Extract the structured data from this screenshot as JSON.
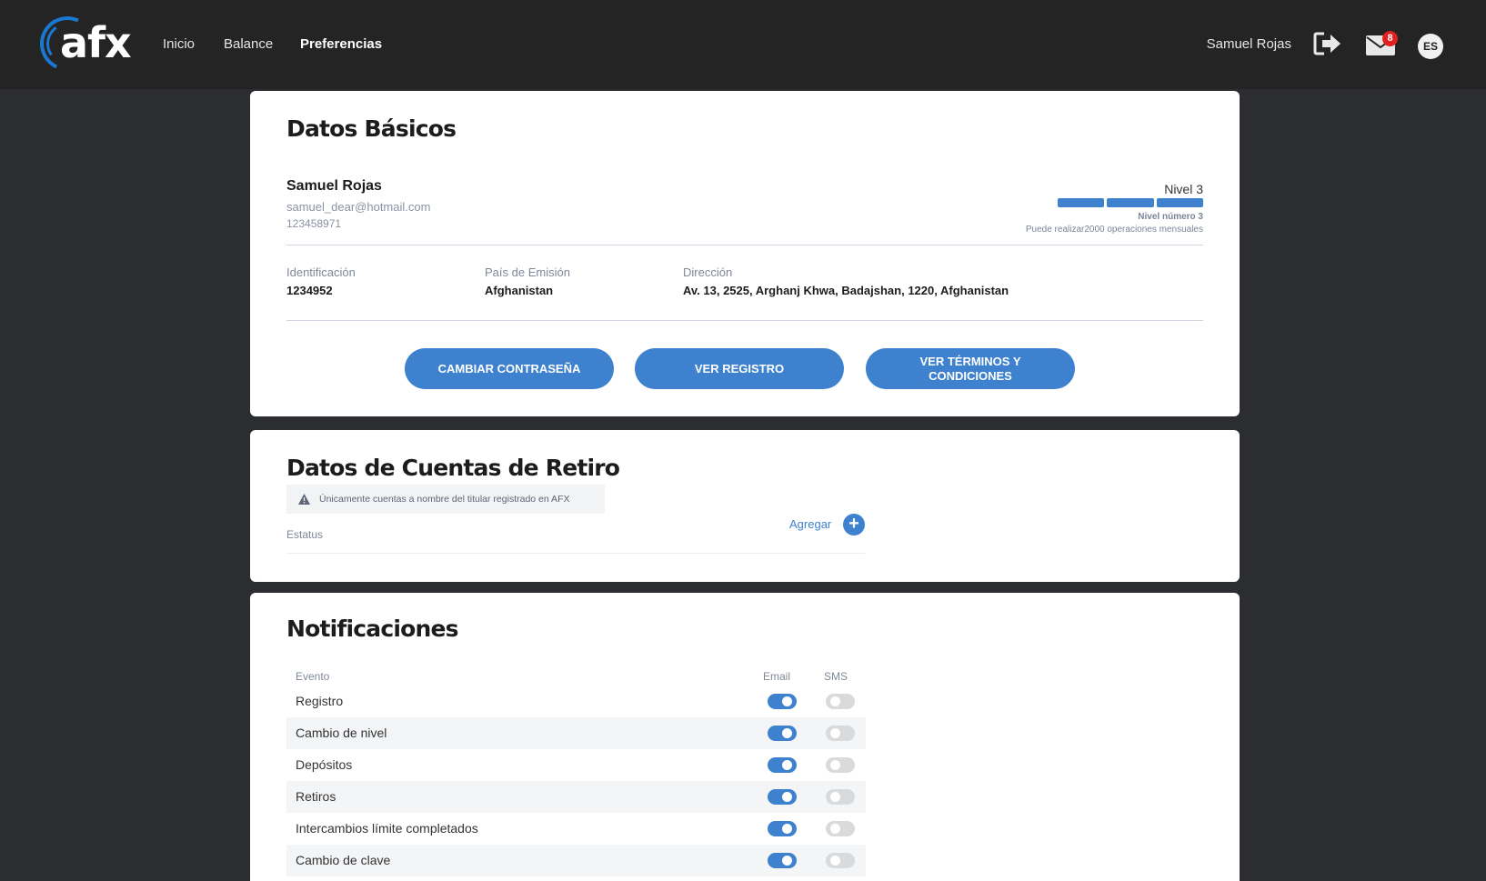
{
  "header": {
    "logo_text": "afx",
    "nav": [
      "Inicio",
      "Balance",
      "Preferencias"
    ],
    "user_name": "Samuel Rojas",
    "mail_count": "8",
    "language": "ES"
  },
  "basic": {
    "title": "Datos Básicos",
    "name": "Samuel Rojas",
    "email": "samuel_dear@hotmail.com",
    "phone": "123458971",
    "level_title": "Nivel 3",
    "level_num": "Nivel número 3",
    "level_desc": "Puede realizar2000 operaciones mensuales",
    "level_bars_filled": 3,
    "fields": [
      {
        "label": "Identificación",
        "value": "1234952"
      },
      {
        "label": "País de Emisión",
        "value": "Afghanistan"
      },
      {
        "label": "Dirección",
        "value": "Av. 13, 2525, Arghanj Khwa, Badajshan, 1220, Afghanistan"
      }
    ],
    "buttons": [
      "CAMBIAR CONTRASEÑA",
      "VER REGISTRO",
      "VER TÉRMINOS Y CONDICIONES"
    ]
  },
  "withdraw": {
    "title": "Datos de Cuentas de Retiro",
    "notice": "Únicamente cuentas a nombre del titular registrado en AFX",
    "add_label": "Agregar",
    "status_label": "Estatus"
  },
  "notifications": {
    "title": "Notificaciones",
    "headers": {
      "event": "Evento",
      "email": "Email",
      "sms": "SMS"
    },
    "rows": [
      {
        "label": "Registro",
        "email": true,
        "sms": false
      },
      {
        "label": "Cambio de nivel",
        "email": true,
        "sms": false
      },
      {
        "label": "Depósitos",
        "email": true,
        "sms": false
      },
      {
        "label": "Retiros",
        "email": true,
        "sms": false
      },
      {
        "label": "Intercambios límite completados",
        "email": true,
        "sms": false
      },
      {
        "label": "Cambio de clave",
        "email": true,
        "sms": false
      }
    ]
  }
}
